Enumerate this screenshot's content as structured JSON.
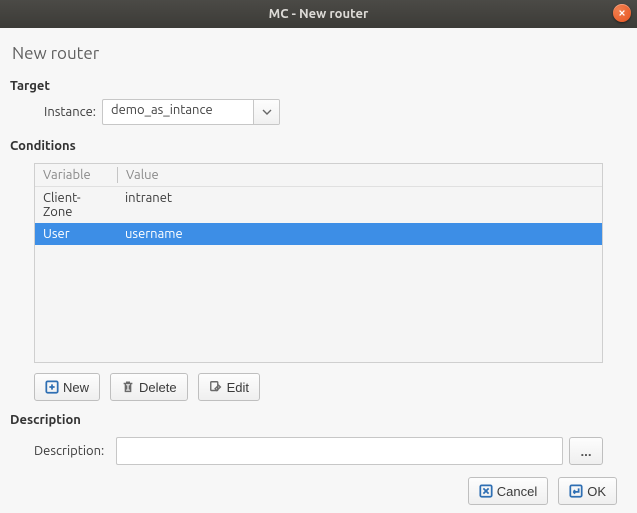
{
  "window": {
    "title": "MC - New router"
  },
  "page": {
    "title": "New router"
  },
  "target": {
    "section_label": "Target",
    "instance_label": "Instance:",
    "instance_value": "demo_as_intance"
  },
  "conditions": {
    "section_label": "Conditions",
    "columns": {
      "variable": "Variable",
      "value": "Value"
    },
    "rows": [
      {
        "variable": "Client-Zone",
        "value": "intranet",
        "selected": false
      },
      {
        "variable": "User",
        "value": "username",
        "selected": true
      }
    ],
    "buttons": {
      "new": "New",
      "delete": "Delete",
      "edit": "Edit"
    }
  },
  "description": {
    "section_label": "Description",
    "field_label": "Description:",
    "value": "",
    "browse_label": "..."
  },
  "footer": {
    "cancel": "Cancel",
    "ok": "OK"
  }
}
